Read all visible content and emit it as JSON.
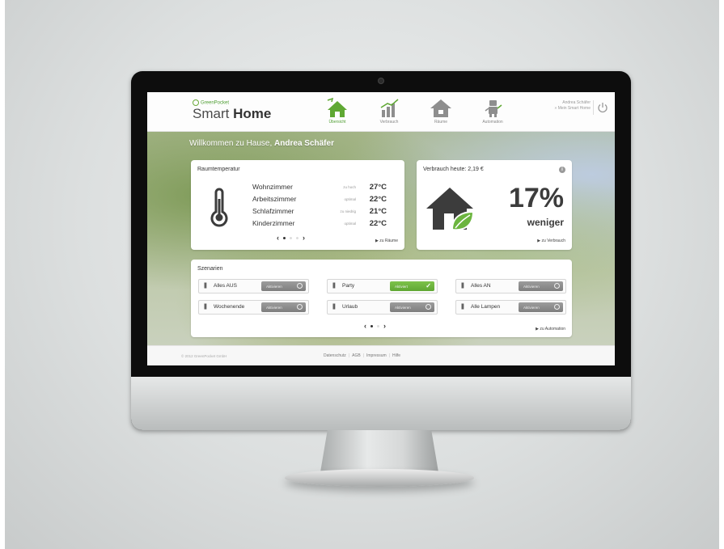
{
  "header": {
    "brand_small": "GreenPocket",
    "brand_smart": "Smart",
    "brand_home": "Home",
    "nav": [
      {
        "label": "Übersicht",
        "icon": "home-icon",
        "active": true
      },
      {
        "label": "Verbrauch",
        "icon": "consumption-chart-icon",
        "active": false
      },
      {
        "label": "Räume",
        "icon": "rooms-house-icon",
        "active": false
      },
      {
        "label": "Automation",
        "icon": "automation-robot-icon",
        "active": false
      }
    ],
    "user_name": "Andrea Schäfer",
    "user_link": "» Mein Smart Home"
  },
  "welcome": {
    "prefix": "Willkommen zu Hause,",
    "name": "Andrea Schäfer"
  },
  "temperature": {
    "title": "Raumtemperatur",
    "rooms": [
      {
        "name": "Wohnzimmer",
        "state": "zu hoch",
        "temp": "27°C"
      },
      {
        "name": "Arbeitszimmer",
        "state": "optimal",
        "temp": "22°C"
      },
      {
        "name": "Schlafzimmer",
        "state": "zu niedrig",
        "temp": "21°C"
      },
      {
        "name": "Kinderzimmer",
        "state": "optimal",
        "temp": "22°C"
      }
    ],
    "pager_prev": "‹",
    "pager_next": "›",
    "link": "▶ zu Räume"
  },
  "usage": {
    "title": "Verbrauch heute: 2,19 €",
    "info": "i",
    "percent": "17%",
    "less": "weniger",
    "link": "▶ zu Verbrauch"
  },
  "scenarios": {
    "title": "Szenarien",
    "items": [
      {
        "label": "Alles AUS",
        "button": "Aktivieren",
        "active": false
      },
      {
        "label": "Party",
        "button": "Aktiviert",
        "active": true
      },
      {
        "label": "Alles AN",
        "button": "Aktivieren",
        "active": false
      },
      {
        "label": "Wochenende",
        "button": "Aktivieren",
        "active": false
      },
      {
        "label": "Urlaub",
        "button": "Aktivieren",
        "active": false
      },
      {
        "label": "Alle Lampen",
        "button": "Aktivieren",
        "active": false
      }
    ],
    "grip": "|||",
    "check": "✓",
    "pager_prev": "‹",
    "pager_next": "›",
    "link": "▶ zu Automation"
  },
  "footer": {
    "copyright": "© 2012 GreenPocket GmbH",
    "links": [
      "Datenschutz",
      "AGB",
      "Impressum",
      "Hilfe"
    ],
    "separator": "|"
  },
  "colors": {
    "brand_green": "#4f9e33",
    "active_button": "#6cb53f"
  }
}
